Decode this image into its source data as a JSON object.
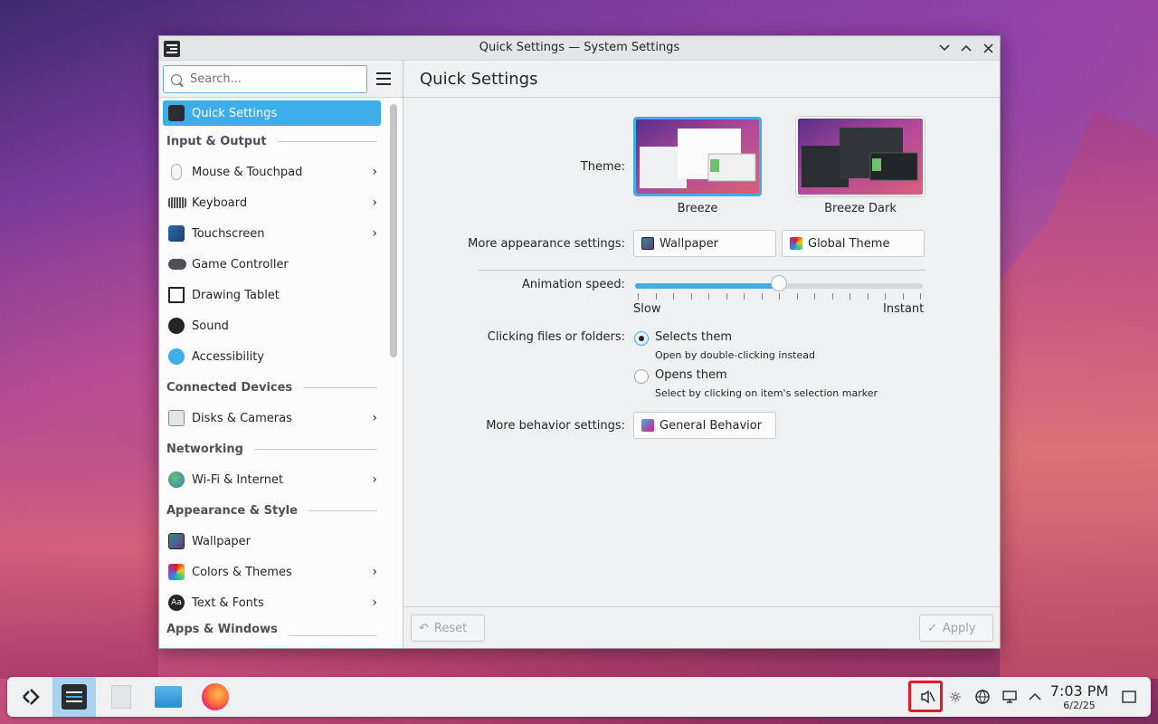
{
  "window": {
    "title": "Quick Settings — System Settings"
  },
  "sidebar": {
    "search_placeholder": "Search...",
    "active_item": "Quick Settings",
    "sections": {
      "input_output": "Input & Output",
      "connected_devices": "Connected Devices",
      "networking": "Networking",
      "appearance_style": "Appearance & Style",
      "apps_windows": "Apps & Windows"
    },
    "items": {
      "mouse": "Mouse & Touchpad",
      "keyboard": "Keyboard",
      "touchscreen": "Touchscreen",
      "game_controller": "Game Controller",
      "drawing_tablet": "Drawing Tablet",
      "sound": "Sound",
      "accessibility": "Accessibility",
      "disks": "Disks & Cameras",
      "wifi": "Wi-Fi & Internet",
      "wallpaper": "Wallpaper",
      "colors": "Colors & Themes",
      "fonts": "Text & Fonts"
    }
  },
  "main": {
    "heading": "Quick Settings",
    "theme_label": "Theme:",
    "theme_options": [
      "Breeze",
      "Breeze Dark"
    ],
    "selected_theme": "Breeze",
    "more_appearance_label": "More appearance settings:",
    "wallpaper_button": "Wallpaper",
    "global_theme_button": "Global Theme",
    "animation_label": "Animation speed:",
    "animation_slow": "Slow",
    "animation_instant": "Instant",
    "animation_level": 0.5,
    "clicking_label": "Clicking files or folders:",
    "option_selects": "Selects them",
    "option_selects_desc": "Open by double-clicking instead",
    "option_opens": "Opens them",
    "option_opens_desc": "Select by clicking on item's selection marker",
    "selected_click_option": "Selects them",
    "more_behavior_label": "More behavior settings:",
    "general_behavior_button": "General Behavior",
    "reset_button": "Reset",
    "apply_button": "Apply"
  },
  "taskbar": {
    "time": "7:03 PM",
    "date": "6/2/25",
    "tray_icons": [
      "muted-speaker-icon",
      "brightness-icon",
      "network-globe-icon",
      "display-icon",
      "expand-tray-icon"
    ]
  },
  "colors": {
    "accent": "#3daee9",
    "highlight_box": "#e01b24"
  }
}
